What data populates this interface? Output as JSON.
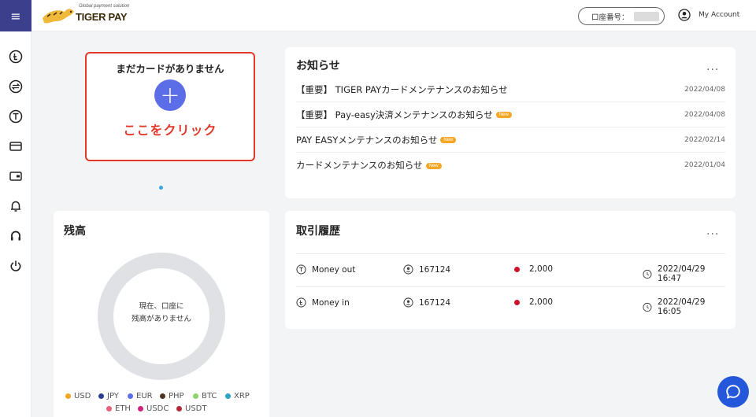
{
  "header": {
    "logo_tagline": "Global payment solution",
    "logo_text": "TIGER PAY",
    "account_label": "口座番号：",
    "my_account": "My Account"
  },
  "sidebar": {
    "items": [
      {
        "icon": "currency-circle-icon"
      },
      {
        "icon": "exchange-circle-icon"
      },
      {
        "icon": "withdraw-circle-icon"
      },
      {
        "icon": "credit-card-icon"
      },
      {
        "icon": "wallet-icon"
      },
      {
        "icon": "bell-icon"
      },
      {
        "icon": "headset-icon"
      },
      {
        "icon": "power-icon"
      }
    ]
  },
  "card_panel": {
    "title": "まだカードがありません",
    "plus": "+",
    "click_text": "ここをクリック"
  },
  "notices": {
    "title": "お知らせ",
    "more": "...",
    "new_label": "New",
    "items": [
      {
        "text": "【重要】 TIGER PAYカードメンテナンスのお知らせ",
        "date": "2022/04/08",
        "new": false
      },
      {
        "text": "【重要】 Pay-easy決済メンテナンスのお知らせ",
        "date": "2022/04/08",
        "new": true
      },
      {
        "text": "PAY EASYメンテナンスのお知らせ",
        "date": "2022/02/14",
        "new": true
      },
      {
        "text": "カードメンテナンスのお知らせ",
        "date": "2022/01/04",
        "new": true
      }
    ]
  },
  "transactions": {
    "title": "取引履歴",
    "more": "...",
    "rows": [
      {
        "type": "Money out",
        "user": "167124",
        "amount": "2,000",
        "datetime": "2022/04/29 16:47"
      },
      {
        "type": "Money in",
        "user": "167124",
        "amount": "2,000",
        "datetime": "2022/04/29 16:05"
      }
    ]
  },
  "balance": {
    "title": "残高",
    "empty_line1": "現在、口座に",
    "empty_line2": "残高がありません",
    "legend": [
      {
        "label": "USD",
        "color": "#f5a623"
      },
      {
        "label": "JPY",
        "color": "#2c3e8f"
      },
      {
        "label": "EUR",
        "color": "#5b6ee8"
      },
      {
        "label": "PHP",
        "color": "#4a3426"
      },
      {
        "label": "BTC",
        "color": "#8fd46a"
      },
      {
        "label": "XRP",
        "color": "#2aa4c8"
      },
      {
        "label": "ETH",
        "color": "#e8607a"
      },
      {
        "label": "USDC",
        "color": "#d1217a"
      },
      {
        "label": "USDT",
        "color": "#b22a3a"
      }
    ]
  },
  "colors": {
    "brand": "#3c3f8c",
    "accent_red": "#e2382a",
    "plus_blue": "#5b6ee8",
    "chat_blue": "#2457d9"
  }
}
